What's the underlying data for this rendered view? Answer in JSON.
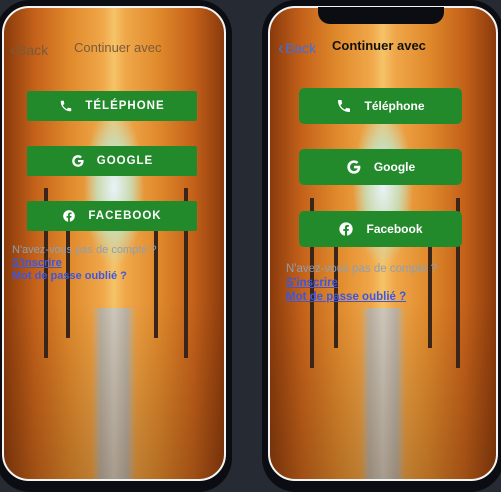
{
  "screens": [
    {
      "header": {
        "back_label": "Back",
        "title": "Continuer avec"
      },
      "buttons": [
        {
          "label": "TÉLÉPHONE",
          "icon": "phone-icon"
        },
        {
          "label": "GOOGLE",
          "icon": "google-icon"
        },
        {
          "label": "FACEBOOK",
          "icon": "facebook-icon"
        }
      ],
      "question": "N'avez-vous pas de compte ?",
      "signup_link": "S'inscrire",
      "forgot_link": "Mot de passe oublié ?"
    },
    {
      "header": {
        "back_label": "Back",
        "title": "Continuer avec"
      },
      "buttons": [
        {
          "label": "Téléphone",
          "icon": "phone-icon"
        },
        {
          "label": "Google",
          "icon": "google-icon"
        },
        {
          "label": "Facebook",
          "icon": "facebook-icon"
        }
      ],
      "question": "N'avez-vous pas de compte ?",
      "signup_link": "S'inscrire",
      "forgot_link": "Mot de passe oublié ?"
    }
  ],
  "colors": {
    "button_green": "#238a2c",
    "link_blue": "#3b57e0",
    "back_blue": "#3f6ee0",
    "background": "#252a33"
  }
}
